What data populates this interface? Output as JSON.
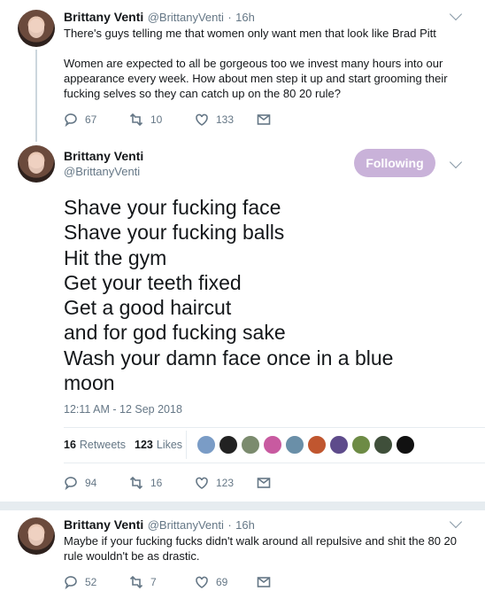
{
  "tweets": [
    {
      "name": "Brittany Venti",
      "handle": "@BrittanyVenti",
      "sep": "·",
      "time": "16h",
      "text_lines": [
        "There's guys telling me that women only want men that look like Brad Pitt",
        "",
        "Women are expected to all be gorgeous too we invest many hours into our",
        "appearance every week. How about men step it up and start grooming their",
        "fucking selves so they can catch up on the 80 20 rule?"
      ],
      "replies": "67",
      "retweets": "10",
      "likes": "133"
    },
    {
      "name": "Brittany Venti",
      "handle": "@BrittanyVenti",
      "follow_label": "Following",
      "text_lines": [
        "Shave your fucking face",
        "Shave your fucking balls",
        "Hit the gym",
        "Get your teeth fixed",
        "Get a good haircut",
        "and for god fucking sake",
        "Wash your damn face once in a blue",
        "moon"
      ],
      "timestamp": "12:11 AM - 12 Sep 2018",
      "retweet_count": "16",
      "retweet_label": "Retweets",
      "like_count": "123",
      "like_label": "Likes",
      "replies": "94",
      "retweets": "16",
      "likes": "123"
    },
    {
      "name": "Brittany Venti",
      "handle": "@BrittanyVenti",
      "sep": "·",
      "time": "16h",
      "text_lines": [
        "Maybe if your fucking fucks didn't walk around all repulsive and shit the 80 20",
        "rule wouldn't be as drastic."
      ],
      "replies": "52",
      "retweets": "7",
      "likes": "69"
    }
  ],
  "colors": {
    "follow_button": "#c9b2d9",
    "secondary_text": "#657786",
    "divider": "#e6ecf0"
  },
  "likers": [
    "#7a9cc6",
    "#222222",
    "#7b8b6e",
    "#c85aa0",
    "#6a8fa8",
    "#c0562f",
    "#5e4b8b",
    "#6d8b45",
    "#3f4f3a",
    "#111111"
  ]
}
